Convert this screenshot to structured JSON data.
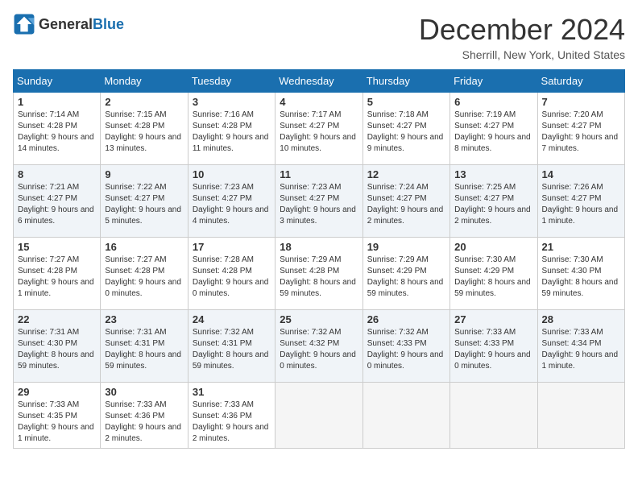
{
  "header": {
    "logo_general": "General",
    "logo_blue": "Blue",
    "title": "December 2024",
    "location": "Sherrill, New York, United States"
  },
  "weekdays": [
    "Sunday",
    "Monday",
    "Tuesday",
    "Wednesday",
    "Thursday",
    "Friday",
    "Saturday"
  ],
  "weeks": [
    [
      {
        "day": "1",
        "sunrise": "7:14 AM",
        "sunset": "4:28 PM",
        "daylight": "9 hours and 14 minutes."
      },
      {
        "day": "2",
        "sunrise": "7:15 AM",
        "sunset": "4:28 PM",
        "daylight": "9 hours and 13 minutes."
      },
      {
        "day": "3",
        "sunrise": "7:16 AM",
        "sunset": "4:28 PM",
        "daylight": "9 hours and 11 minutes."
      },
      {
        "day": "4",
        "sunrise": "7:17 AM",
        "sunset": "4:27 PM",
        "daylight": "9 hours and 10 minutes."
      },
      {
        "day": "5",
        "sunrise": "7:18 AM",
        "sunset": "4:27 PM",
        "daylight": "9 hours and 9 minutes."
      },
      {
        "day": "6",
        "sunrise": "7:19 AM",
        "sunset": "4:27 PM",
        "daylight": "9 hours and 8 minutes."
      },
      {
        "day": "7",
        "sunrise": "7:20 AM",
        "sunset": "4:27 PM",
        "daylight": "9 hours and 7 minutes."
      }
    ],
    [
      {
        "day": "8",
        "sunrise": "7:21 AM",
        "sunset": "4:27 PM",
        "daylight": "9 hours and 6 minutes."
      },
      {
        "day": "9",
        "sunrise": "7:22 AM",
        "sunset": "4:27 PM",
        "daylight": "9 hours and 5 minutes."
      },
      {
        "day": "10",
        "sunrise": "7:23 AM",
        "sunset": "4:27 PM",
        "daylight": "9 hours and 4 minutes."
      },
      {
        "day": "11",
        "sunrise": "7:23 AM",
        "sunset": "4:27 PM",
        "daylight": "9 hours and 3 minutes."
      },
      {
        "day": "12",
        "sunrise": "7:24 AM",
        "sunset": "4:27 PM",
        "daylight": "9 hours and 2 minutes."
      },
      {
        "day": "13",
        "sunrise": "7:25 AM",
        "sunset": "4:27 PM",
        "daylight": "9 hours and 2 minutes."
      },
      {
        "day": "14",
        "sunrise": "7:26 AM",
        "sunset": "4:27 PM",
        "daylight": "9 hours and 1 minute."
      }
    ],
    [
      {
        "day": "15",
        "sunrise": "7:27 AM",
        "sunset": "4:28 PM",
        "daylight": "9 hours and 1 minute."
      },
      {
        "day": "16",
        "sunrise": "7:27 AM",
        "sunset": "4:28 PM",
        "daylight": "9 hours and 0 minutes."
      },
      {
        "day": "17",
        "sunrise": "7:28 AM",
        "sunset": "4:28 PM",
        "daylight": "9 hours and 0 minutes."
      },
      {
        "day": "18",
        "sunrise": "7:29 AM",
        "sunset": "4:28 PM",
        "daylight": "8 hours and 59 minutes."
      },
      {
        "day": "19",
        "sunrise": "7:29 AM",
        "sunset": "4:29 PM",
        "daylight": "8 hours and 59 minutes."
      },
      {
        "day": "20",
        "sunrise": "7:30 AM",
        "sunset": "4:29 PM",
        "daylight": "8 hours and 59 minutes."
      },
      {
        "day": "21",
        "sunrise": "7:30 AM",
        "sunset": "4:30 PM",
        "daylight": "8 hours and 59 minutes."
      }
    ],
    [
      {
        "day": "22",
        "sunrise": "7:31 AM",
        "sunset": "4:30 PM",
        "daylight": "8 hours and 59 minutes."
      },
      {
        "day": "23",
        "sunrise": "7:31 AM",
        "sunset": "4:31 PM",
        "daylight": "8 hours and 59 minutes."
      },
      {
        "day": "24",
        "sunrise": "7:32 AM",
        "sunset": "4:31 PM",
        "daylight": "8 hours and 59 minutes."
      },
      {
        "day": "25",
        "sunrise": "7:32 AM",
        "sunset": "4:32 PM",
        "daylight": "9 hours and 0 minutes."
      },
      {
        "day": "26",
        "sunrise": "7:32 AM",
        "sunset": "4:33 PM",
        "daylight": "9 hours and 0 minutes."
      },
      {
        "day": "27",
        "sunrise": "7:33 AM",
        "sunset": "4:33 PM",
        "daylight": "9 hours and 0 minutes."
      },
      {
        "day": "28",
        "sunrise": "7:33 AM",
        "sunset": "4:34 PM",
        "daylight": "9 hours and 1 minute."
      }
    ],
    [
      {
        "day": "29",
        "sunrise": "7:33 AM",
        "sunset": "4:35 PM",
        "daylight": "9 hours and 1 minute."
      },
      {
        "day": "30",
        "sunrise": "7:33 AM",
        "sunset": "4:36 PM",
        "daylight": "9 hours and 2 minutes."
      },
      {
        "day": "31",
        "sunrise": "7:33 AM",
        "sunset": "4:36 PM",
        "daylight": "9 hours and 2 minutes."
      },
      null,
      null,
      null,
      null
    ]
  ]
}
